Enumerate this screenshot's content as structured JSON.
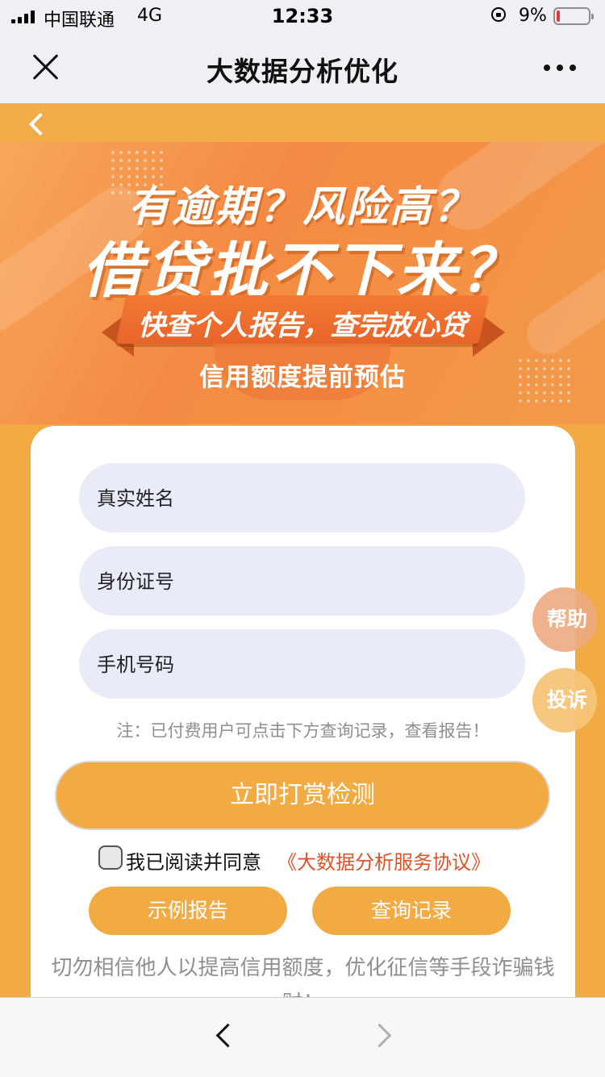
{
  "status_bar": {
    "carrier": "中国联通",
    "network": "4G",
    "time": "12:33",
    "battery": "9%"
  },
  "nav": {
    "title": "大数据分析优化"
  },
  "banner": {
    "line1": "有逾期？风险高？",
    "line2": "借贷批不下来？",
    "ribbon": "快查个人报告，查完放心贷",
    "line3": "信用额度提前预估"
  },
  "form": {
    "name_placeholder": "真实姓名",
    "id_placeholder": "身份证号",
    "phone_placeholder": "手机号码",
    "note": "注：已付费用户可点击下方查询记录，查看报告！",
    "submit": "立即打赏检测",
    "agree_text": "我已阅读并同意",
    "agree_link": "《大数据分析服务协议》",
    "sample_report": "示例报告",
    "query_records": "查询记录",
    "warning": "切勿相信他人以提高信用额度，优化征信等手段诈骗钱财！"
  },
  "floating": {
    "help": "帮助",
    "complaint": "投诉"
  },
  "colors": {
    "accent": "#F2AB43",
    "link": "#E0522A",
    "field_bg": "#E9EBF8"
  }
}
